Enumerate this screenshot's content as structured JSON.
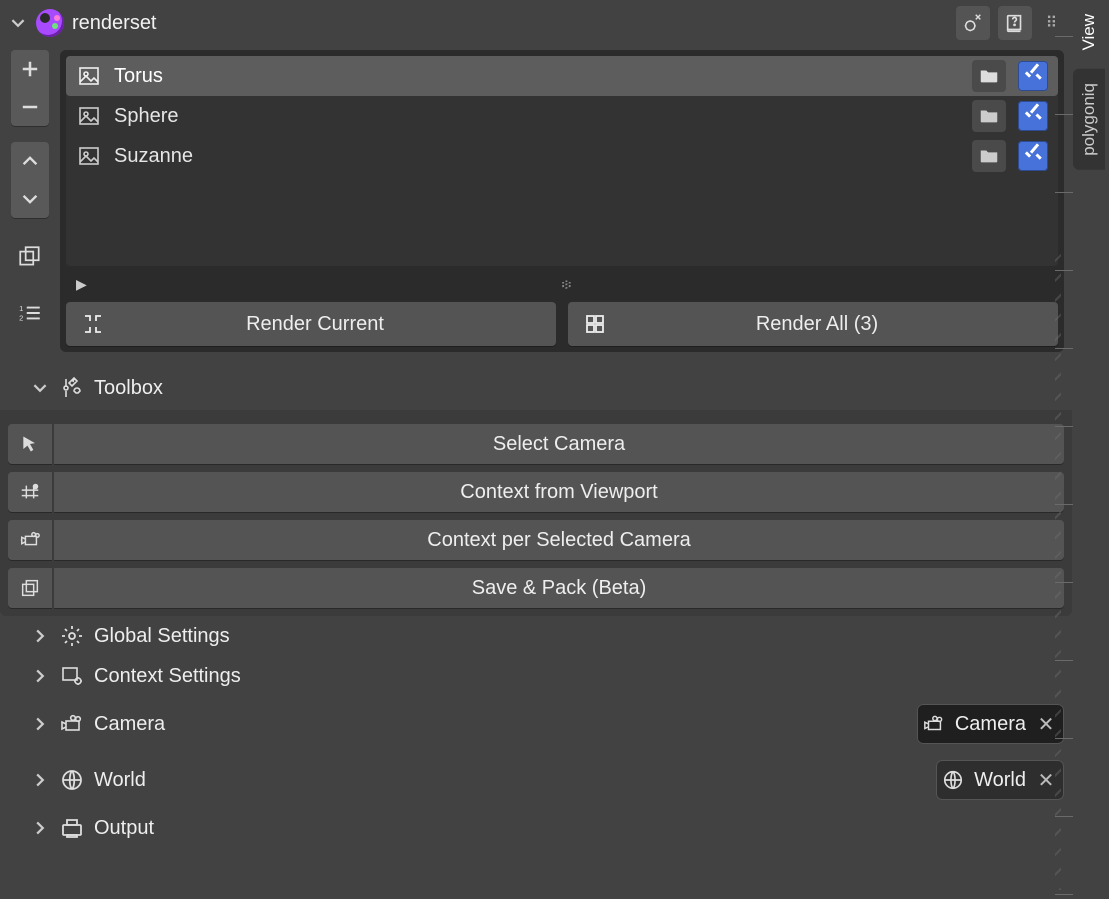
{
  "header": {
    "title": "renderset"
  },
  "contexts": [
    {
      "name": "Torus",
      "selected": true,
      "checked": true
    },
    {
      "name": "Sphere",
      "selected": false,
      "checked": true
    },
    {
      "name": "Suzanne",
      "selected": false,
      "checked": true
    }
  ],
  "render_buttons": {
    "current": "Render Current",
    "all": "Render All (3)"
  },
  "toolbox": {
    "title": "Toolbox",
    "select_camera": "Select Camera",
    "context_from_viewport": "Context from Viewport",
    "context_per_selected_camera": "Context per Selected Camera",
    "save_pack": "Save & Pack (Beta)"
  },
  "panels": {
    "global_settings": "Global Settings",
    "context_settings": "Context Settings",
    "camera": "Camera",
    "world": "World",
    "output": "Output"
  },
  "chips": {
    "camera": "Camera",
    "world": "World"
  },
  "tabs": {
    "view": "View",
    "polygoniq": "polygoniq"
  }
}
